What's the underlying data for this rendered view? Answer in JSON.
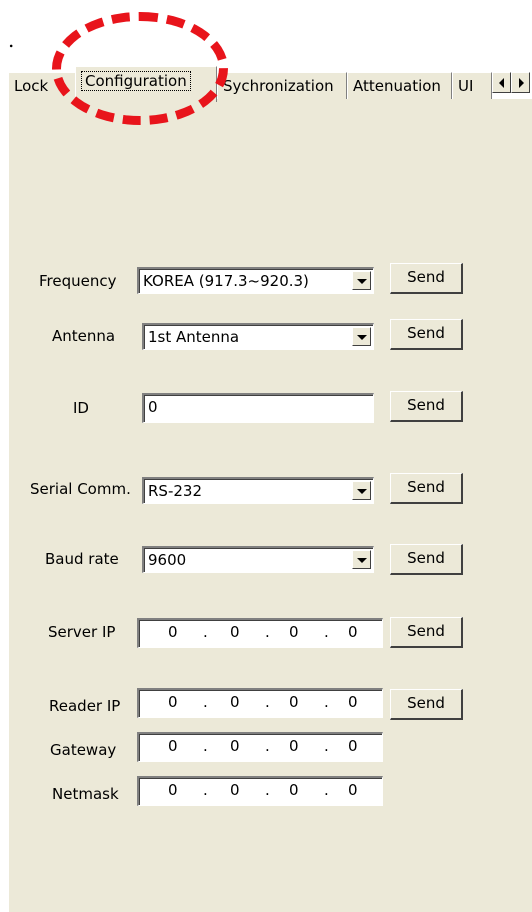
{
  "leading_mark": ".",
  "tabs": [
    {
      "label": "Lock",
      "selected": false
    },
    {
      "label": "Configuration",
      "selected": true
    },
    {
      "label": "Sychronization",
      "selected": false
    },
    {
      "label": "Attenuation",
      "selected": false
    },
    {
      "label": "UI",
      "selected": false
    }
  ],
  "form": {
    "frequency": {
      "label": "Frequency",
      "value": "KOREA  (917.3~920.3)",
      "button": "Send"
    },
    "antenna": {
      "label": "Antenna",
      "value": "1st Antenna",
      "button": "Send"
    },
    "id": {
      "label": "ID",
      "value": "0",
      "button": "Send"
    },
    "serial": {
      "label": "Serial Comm.",
      "value": "RS-232",
      "button": "Send"
    },
    "baud": {
      "label": "Baud rate",
      "value": "9600",
      "button": "Send"
    },
    "server_ip": {
      "label": "Server IP",
      "octets": [
        "0",
        "0",
        "0",
        "0"
      ],
      "button": "Send"
    },
    "reader_ip": {
      "label": "Reader IP",
      "octets": [
        "0",
        "0",
        "0",
        "0"
      ],
      "button": "Send"
    },
    "gateway": {
      "label": "Gateway",
      "octets": [
        "0",
        "0",
        "0",
        "0"
      ]
    },
    "netmask": {
      "label": "Netmask",
      "octets": [
        "0",
        "0",
        "0",
        "0"
      ]
    }
  },
  "ip_separator": ".",
  "colors": {
    "panel": "#ece9d8",
    "annotation": "#e8141b"
  },
  "icons": {
    "scroll_left": "triangle-left",
    "scroll_right": "triangle-right",
    "dropdown": "triangle-down"
  }
}
